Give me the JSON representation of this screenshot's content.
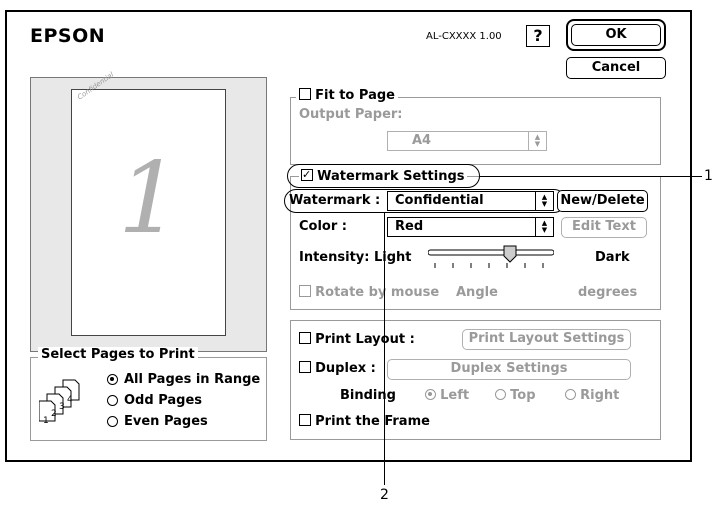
{
  "header": {
    "logo": "EPSON",
    "model": "AL-CXXXX 1.00",
    "help": "?",
    "ok": "OK",
    "cancel": "Cancel"
  },
  "preview": {
    "page_number": "1",
    "watermark_text": "Confidential"
  },
  "select_pages": {
    "legend": "Select Pages to Print",
    "options": [
      "All Pages in Range",
      "Odd Pages",
      "Even Pages"
    ],
    "selected": 0,
    "stack_digits": [
      "1",
      "2",
      "3",
      "4"
    ]
  },
  "fit": {
    "label": "Fit to Page",
    "output_paper_label": "Output Paper:",
    "output_paper_value": "A4",
    "checked": false
  },
  "watermark": {
    "settings_label": "Watermark Settings",
    "checked": true,
    "watermark_label": "Watermark :",
    "watermark_value": "Confidential",
    "new_delete": "New/Delete",
    "color_label": "Color :",
    "color_value": "Red",
    "edit_text": "Edit Text",
    "intensity_label": "Intensity: Light",
    "intensity_dark": "Dark",
    "intensity_level": 0.67,
    "rotate_label": "Rotate by mouse",
    "angle_label": "Angle",
    "degrees_label": "degrees"
  },
  "layout": {
    "print_layout_label": "Print Layout :",
    "print_layout_settings": "Print Layout Settings",
    "duplex_label": "Duplex :",
    "duplex_settings": "Duplex Settings",
    "binding_label": "Binding",
    "binding_options": [
      "Left",
      "Top",
      "Right"
    ],
    "print_frame_label": "Print the Frame"
  },
  "callouts": {
    "one": "1",
    "two": "2"
  }
}
